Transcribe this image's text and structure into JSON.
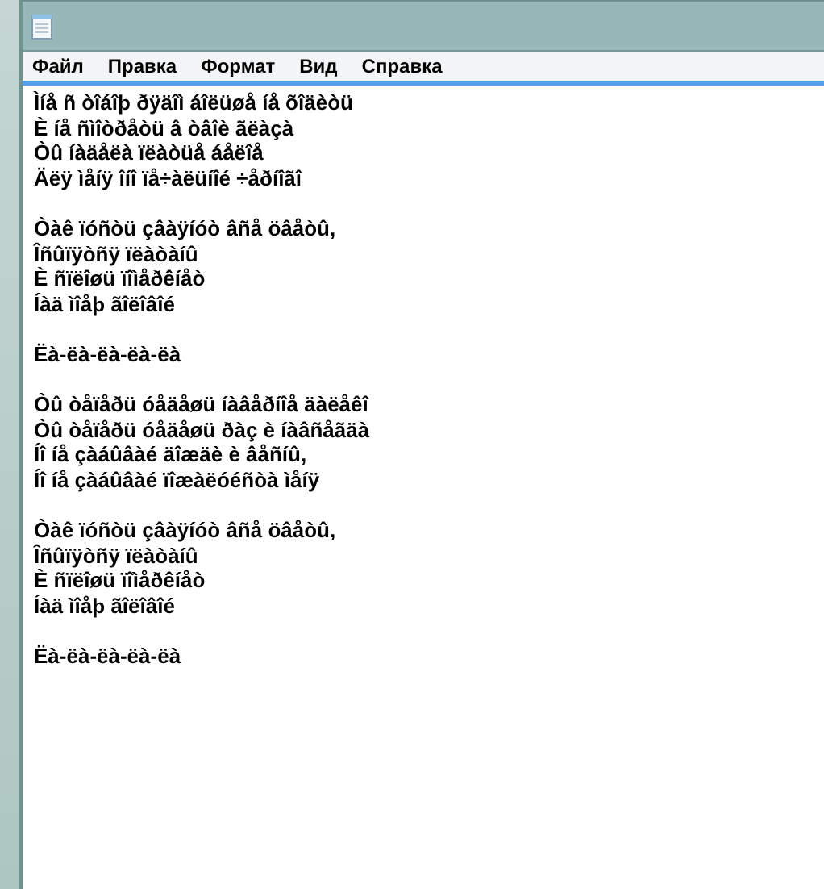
{
  "menu": [
    "Файл",
    "Правка",
    "Формат",
    "Вид",
    "Справка"
  ],
  "stanzas": [
    [
      "Ìíå ñ òîáîþ ðÿäîì áîëüøå íå õîäèòü",
      "È íå ñìîòðåòü â òâîè ãëàçà",
      "Òû íàäåëà ïëàòüå áåëîå",
      "Äëÿ ìåíÿ îíî ïå÷àëüíîé ÷åðíîãî"
    ],
    [
      "Òàê ïóñòü çâàÿíóò âñå öâåòû,",
      "Îñûïÿòñÿ ïëàòàíû",
      "È ñïëîøü ïîìåðêíåò",
      "Íàä ìîåþ ãîëîâîé"
    ],
    [
      "Ëà-ëà-ëà-ëà-ëà"
    ],
    [
      "Òû òåïåðü óåäåøü íàâåðíîå äàëåêî",
      "Òû òåïåðü óåäåøü ðàç è íàâñåãäà",
      "Íî íå çàáûâàé äîæäè è âåñíû,",
      "Íî íå çàáûâàé ïîæàëóéñòà ìåíÿ"
    ],
    [
      "Òàê ïóñòü çâàÿíóò âñå öâåòû,",
      "Îñûïÿòñÿ ïëàòàíû",
      "È ñïëîøü ïîìåðêíåò",
      "Íàä ìîåþ ãîëîâîé"
    ],
    [
      "Ëà-ëà-ëà-ëà-ëà"
    ]
  ]
}
